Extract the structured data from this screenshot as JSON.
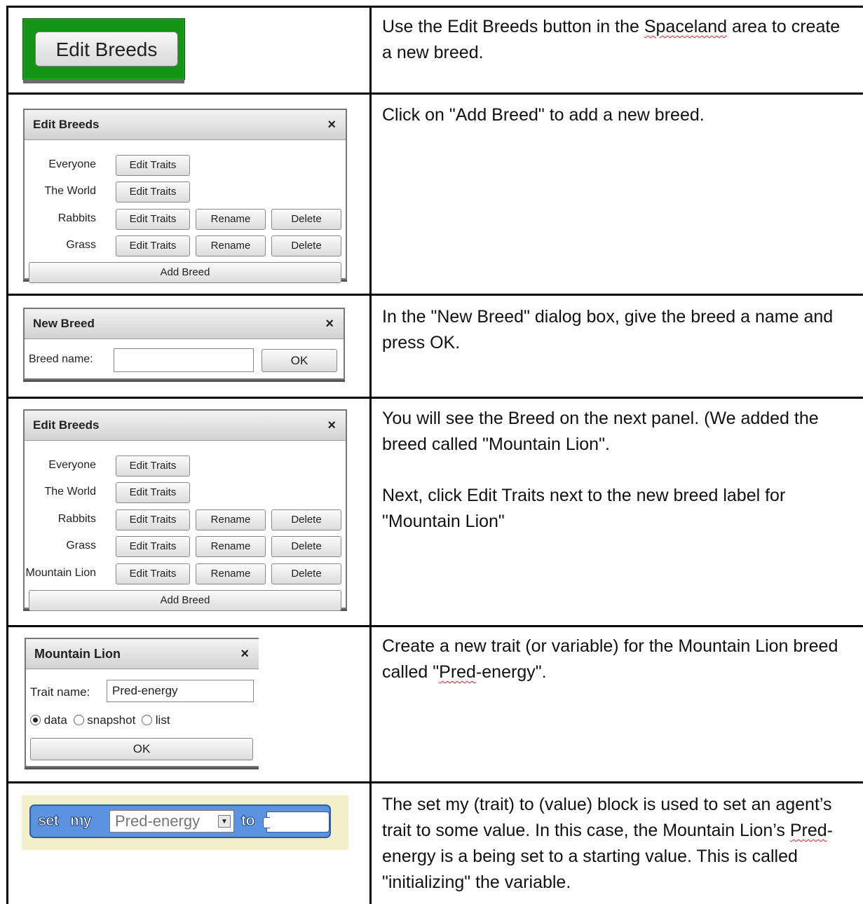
{
  "rows": [
    {
      "description": [
        "Use the Edit Breeds button in the ",
        "Spaceland",
        " area to create a new breed."
      ],
      "ui": {
        "button_label": "Edit Breeds"
      }
    },
    {
      "description": "Click on \"Add Breed\" to add a new breed.",
      "ui": {
        "title": "Edit Breeds",
        "close": "×",
        "breeds": [
          {
            "name": "Everyone",
            "buttons": [
              "Edit Traits"
            ]
          },
          {
            "name": "The World",
            "buttons": [
              "Edit Traits"
            ]
          },
          {
            "name": "Rabbits",
            "buttons": [
              "Edit Traits",
              "Rename",
              "Delete"
            ]
          },
          {
            "name": "Grass",
            "buttons": [
              "Edit Traits",
              "Rename",
              "Delete"
            ]
          }
        ],
        "add_label": "Add Breed"
      }
    },
    {
      "description": "In the \"New Breed\" dialog box, give the breed a name and press OK.",
      "ui": {
        "title": "New Breed",
        "close": "×",
        "field_label": "Breed name:",
        "field_value": "",
        "ok_label": "OK"
      }
    },
    {
      "description": [
        "You will see the Breed on the next panel.  (We added the breed called \"Mountain Lion\".",
        "Next, click Edit Traits next to the new breed label for \"Mountain Lion\""
      ],
      "ui": {
        "title": "Edit Breeds",
        "close": "×",
        "breeds": [
          {
            "name": "Everyone",
            "buttons": [
              "Edit Traits"
            ]
          },
          {
            "name": "The World",
            "buttons": [
              "Edit Traits"
            ]
          },
          {
            "name": "Rabbits",
            "buttons": [
              "Edit Traits",
              "Rename",
              "Delete"
            ]
          },
          {
            "name": "Grass",
            "buttons": [
              "Edit Traits",
              "Rename",
              "Delete"
            ]
          },
          {
            "name": "Mountain Lion",
            "buttons": [
              "Edit Traits",
              "Rename",
              "Delete"
            ]
          }
        ],
        "add_label": "Add Breed"
      }
    },
    {
      "description": [
        "Create a new trait (or variable) for the Mountain Lion breed called \"",
        "Pred",
        "-energy\"."
      ],
      "ui": {
        "title": "Mountain Lion",
        "close": "×",
        "field_label": "Trait name:",
        "field_value": "Pred-energy",
        "radios": [
          {
            "label": "data",
            "selected": true
          },
          {
            "label": "snapshot",
            "selected": false
          },
          {
            "label": "list",
            "selected": false
          }
        ],
        "ok_label": "OK"
      }
    },
    {
      "description": [
        "The set my (trait) to (value) block is used to set an agent’s trait to some value.  In this case, the Mountain Lion’s ",
        "Pred",
        "-energy is a being set to a starting value.  This is called \"initializing\" the variable."
      ],
      "ui": {
        "keyword_set": "set",
        "keyword_my": "my",
        "dropdown_value": "Pred-energy",
        "dropdown_arrow": "▼",
        "keyword_to": "to"
      }
    }
  ],
  "colors": {
    "green_frame": "#149414",
    "block_blue": "#5b93e0",
    "block_bg": "#f3efc9"
  }
}
